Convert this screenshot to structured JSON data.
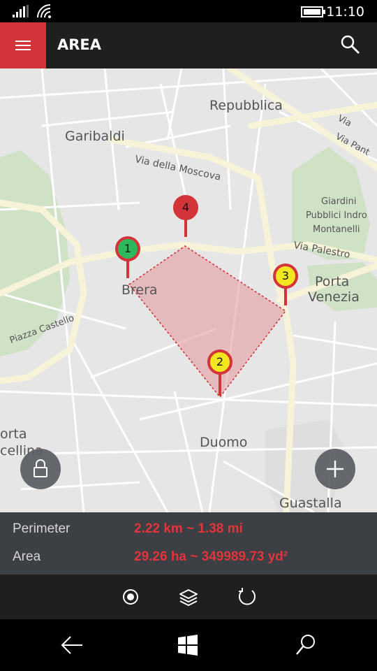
{
  "status_bar": {
    "time": "11:10",
    "icons": [
      "signal-icon",
      "wifi-icon",
      "battery-icon"
    ]
  },
  "app_bar": {
    "title": "AREA",
    "menu_icon": "hamburger-icon",
    "search_icon": "search-icon",
    "accent": "#d2343a"
  },
  "map": {
    "labels": {
      "repubblica": "Repubblica",
      "garibaldi": "Garibaldi",
      "via_moscova": "Via della Moscova",
      "via_panta": "Via Pant",
      "via_e": "Via",
      "giardini": "Giardini",
      "pubblici": "Pubblici Indro",
      "montanelli": "Montanelli",
      "via_palestro": "Via Palestro",
      "brera": "Brera",
      "porta": "Porta",
      "venezia": "Venezia",
      "piazza_castello": "Piazza Castello",
      "orta": "orta",
      "cellina": "cellina",
      "duomo": "Duomo",
      "guastalla": "Guastalla"
    },
    "markers": [
      {
        "number": "1",
        "color": "#2eb85c"
      },
      {
        "number": "2",
        "color": "#f1e61f"
      },
      {
        "number": "3",
        "color": "#f1e61f"
      },
      {
        "number": "4",
        "color": "#d2343a"
      }
    ],
    "polygon_fill": "#e49ca0",
    "lock_icon": "lock-icon",
    "add_icon": "plus-icon"
  },
  "measurements": {
    "perimeter_label": "Perimeter",
    "perimeter_value": "2.22 km ~ 1.38 mi",
    "area_label": "Area",
    "area_value": "29.26 ha ~ 349989.73 yd²",
    "value_color": "#e2343b"
  },
  "command_bar": {
    "icons": [
      "record-icon",
      "layers-icon",
      "refresh-icon"
    ]
  },
  "nav_bar": {
    "icons": [
      "back-icon",
      "windows-icon",
      "search-icon"
    ]
  }
}
